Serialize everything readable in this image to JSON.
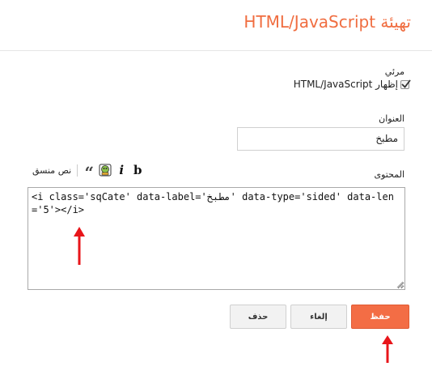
{
  "header": {
    "title": "تهيئة HTML/JavaScript"
  },
  "visibility": {
    "label": "مرئي",
    "show_label": "إظهار HTML/JavaScript",
    "checked": true
  },
  "title_field": {
    "label": "العنوان",
    "value": "مطبخ"
  },
  "toolbar": {
    "rich_text_label": "نص منسق",
    "bold_label": "b",
    "italic_label": "i",
    "quote_label": "“"
  },
  "content_field": {
    "label": "المحتوى",
    "value": "<i class='sqCate' data-label='مطبخ' data-type='sided' data-len='5'></i>"
  },
  "buttons": {
    "save": "حفظ",
    "cancel": "إلغاء",
    "delete": "حذف"
  },
  "colors": {
    "accent": "#f36d45",
    "annotation_arrow": "#e8151a"
  }
}
